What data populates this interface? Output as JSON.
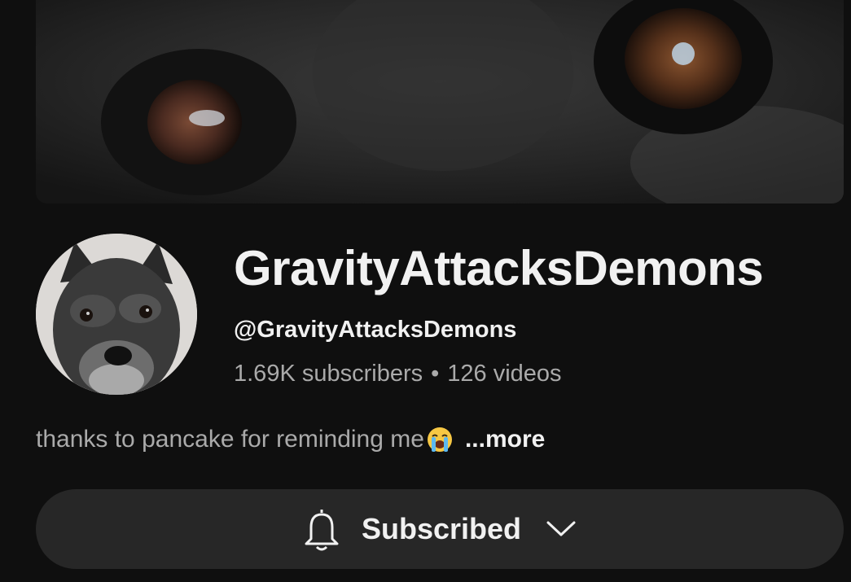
{
  "channel": {
    "name": "GravityAttacksDemons",
    "handle": "@GravityAttacksDemons",
    "subscribers": "1.69K subscribers",
    "separator": "•",
    "videos": "126 videos",
    "description": "thanks to pancake for reminding me",
    "description_emoji": "loudly-crying-face-emoji",
    "more_label": "...more"
  },
  "subscribe_button": {
    "label": "Subscribed",
    "bell_icon": "bell-icon",
    "dropdown_icon": "chevron-down-icon"
  },
  "colors": {
    "background": "#0f0f0f",
    "primary_text": "#f1f1f1",
    "secondary_text": "#aaaaaa",
    "button_bg": "#272727"
  }
}
